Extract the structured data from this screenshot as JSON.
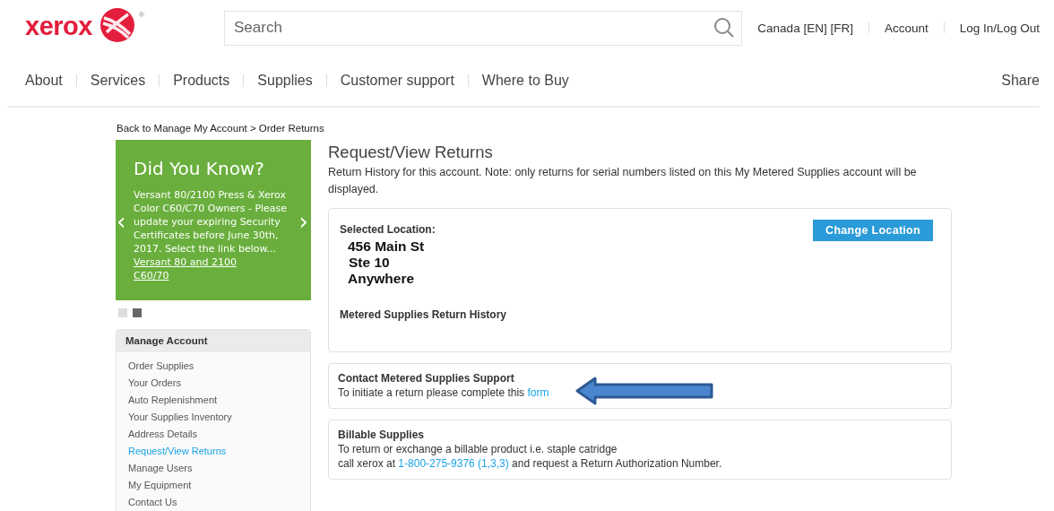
{
  "header": {
    "logo": {
      "text": "xerox",
      "mark": "®"
    },
    "search": {
      "placeholder": "Search"
    },
    "utility_links": [
      "Canada [EN] [FR]",
      "Account",
      "Log In/Log Out"
    ]
  },
  "nav": {
    "items": [
      "About",
      "Services",
      "Products",
      "Supplies",
      "Customer support",
      "Where to Buy"
    ],
    "share": "Share"
  },
  "breadcrumb": "Back to Manage My Account > Order Returns",
  "promo": {
    "title": "Did You Know?",
    "body": "Versant 80/2100 Press & Xerox Color C60/C70 Owners - Please update your expiring Security Certificates before June 30th, 2017. Select the link below...",
    "link": "Versant 80 and 2100 C60/70",
    "prev": "‹",
    "next": "›",
    "dots": [
      {
        "selected": false
      },
      {
        "selected": true
      }
    ]
  },
  "sidebar": {
    "title": "Manage Account",
    "items": [
      {
        "label": "Order Supplies",
        "selected": false
      },
      {
        "label": "Your Orders",
        "selected": false
      },
      {
        "label": "Auto Replenishment",
        "selected": false
      },
      {
        "label": "Your Supplies Inventory",
        "selected": false
      },
      {
        "label": "Address Details",
        "selected": false
      },
      {
        "label": "Request/View Returns",
        "selected": true
      },
      {
        "label": "Manage Users",
        "selected": false
      },
      {
        "label": "My Equipment",
        "selected": false
      },
      {
        "label": "Contact Us",
        "selected": false
      }
    ]
  },
  "main": {
    "title": "Request/View Returns",
    "note": "Return History for this account. Note: only returns for serial numbers listed on this My Metered Supplies account will be displayed.",
    "location": {
      "label": "Selected Location:",
      "address": [
        "456 Main St",
        "Ste 10",
        "Anywhere"
      ],
      "button": "Change Location",
      "history_title": "Metered Supplies Return History"
    },
    "cards": [
      {
        "title": "Contact Metered Supplies Support",
        "arrow": true,
        "lines": [
          [
            {
              "kind": "text",
              "text": "To initiate a return please complete this "
            },
            {
              "kind": "link",
              "text": "form"
            }
          ]
        ]
      },
      {
        "title": "Billable Supplies",
        "arrow": false,
        "lines": [
          [
            {
              "kind": "text",
              "text": "To return or exchange a billable product i.e. staple catridge"
            }
          ],
          [
            {
              "kind": "text",
              "text": "call xerox at "
            },
            {
              "kind": "link",
              "text": "1-800-275-9376 (1,3,3)"
            },
            {
              "kind": "text",
              "text": " and request a Return Authorization Number."
            }
          ]
        ]
      }
    ]
  }
}
